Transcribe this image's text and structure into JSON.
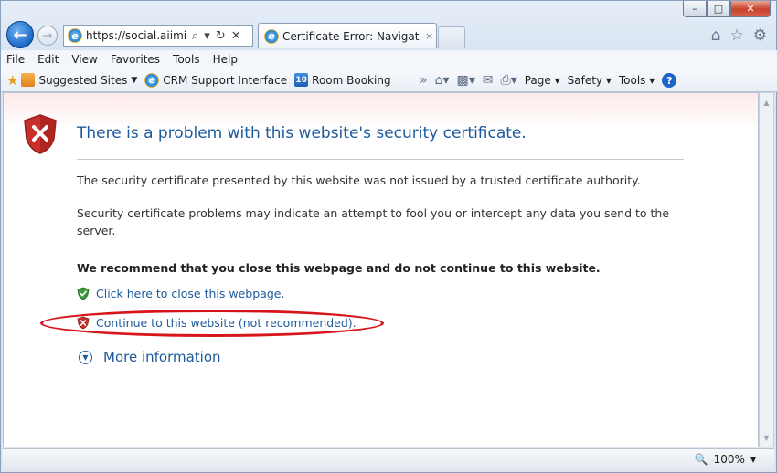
{
  "window": {
    "min_icon": "–",
    "max_icon": "□",
    "close_icon": "✕"
  },
  "nav": {
    "url": "https://social.aiimi...",
    "search_icon": "⌕",
    "dropdown_icon": "▾",
    "refresh_icon": "↻",
    "stop_icon": "✕",
    "tab_label": "Certificate Error: Navigation...",
    "tab_close": "×"
  },
  "menu": {
    "items": [
      "File",
      "Edit",
      "View",
      "Favorites",
      "Tools",
      "Help"
    ]
  },
  "favorites": {
    "suggested_sites": "Suggested Sites",
    "crm": "CRM Support Interface",
    "room_booking": "Room Booking",
    "room_booking_badge": "10",
    "overflow": "»"
  },
  "command_bar": {
    "page": "Page",
    "safety": "Safety",
    "tools": "Tools",
    "help_badge": "?"
  },
  "content": {
    "title": "There is a problem with this website's security certificate.",
    "p1": "The security certificate presented by this website was not issued by a trusted certificate authority.",
    "p2": "Security certificate problems may indicate an attempt to fool you or intercept any data you send to the server.",
    "p3": "We recommend that you close this webpage and do not continue to this website.",
    "close_link": "Click here to close this webpage.",
    "continue_link": "Continue to this website (not recommended).",
    "more_info": "More information"
  },
  "status": {
    "zoom": "100%"
  },
  "colors": {
    "link": "#1d5a9c",
    "highlight": "#d8151b",
    "error_red": "#c9302c",
    "safe_green": "#3a9a3a"
  }
}
